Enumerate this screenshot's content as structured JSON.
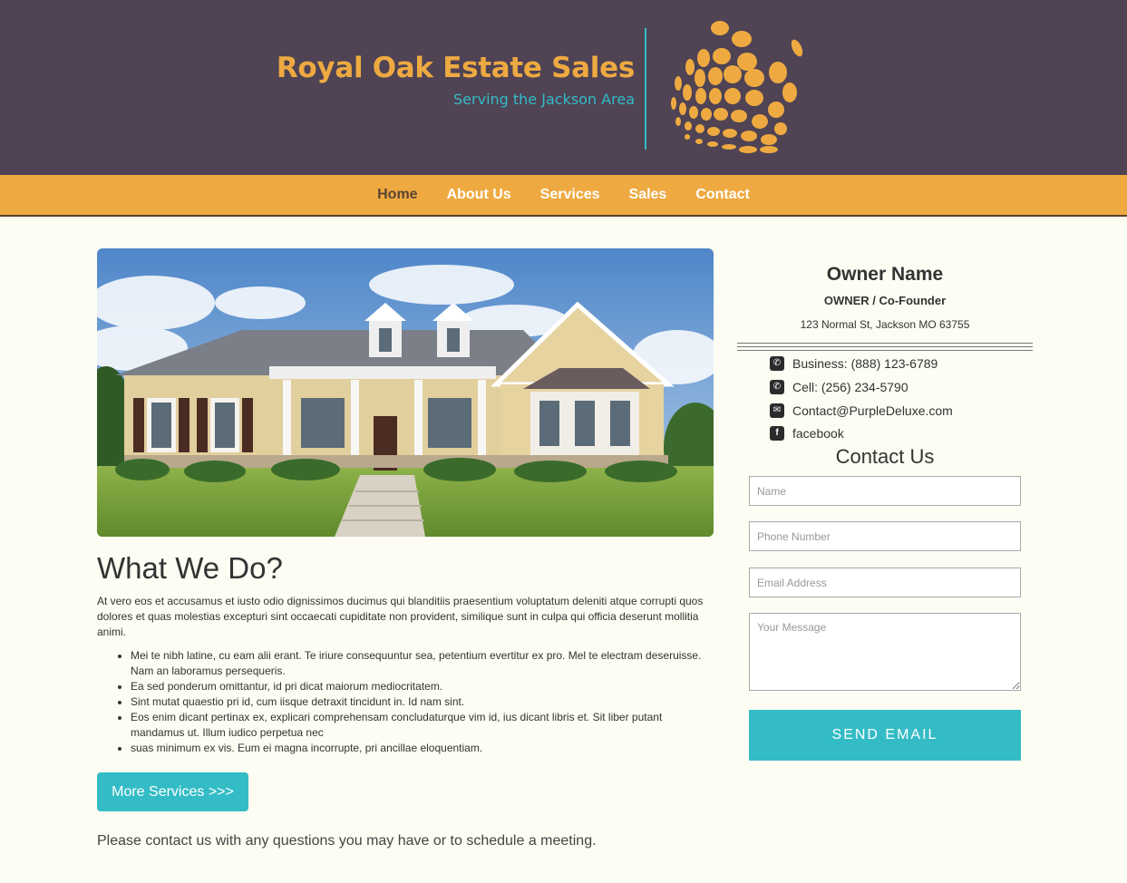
{
  "brand": {
    "title": "Royal Oak Estate Sales",
    "subtitle": "Serving the Jackson Area",
    "logo_icon": "dotted-sphere-logo"
  },
  "nav": {
    "items": [
      {
        "label": "Home",
        "active": true
      },
      {
        "label": "About Us",
        "active": false
      },
      {
        "label": "Services",
        "active": false
      },
      {
        "label": "Sales",
        "active": false
      },
      {
        "label": "Contact",
        "active": false
      }
    ]
  },
  "main": {
    "heading": "What We Do?",
    "paragraph": "At vero eos et accusamus et iusto odio dignissimos ducimus qui blanditiis praesentium voluptatum deleniti atque corrupti quos dolores et quas molestias excepturi sint occaecati cupiditate non provident, similique sunt in culpa qui officia deserunt mollitia animi.",
    "bullets": [
      "Mei te nibh latine, cu eam alii erant. Te iriure consequuntur sea, petentium evertitur ex pro. Mel te electram deseruisse. Nam an laboramus persequeris.",
      "Ea sed ponderum omittantur, id pri dicat maiorum mediocritatem.",
      "Sint mutat quaestio pri id, cum iisque detraxit tincidunt in. Id nam sint.",
      "Eos enim dicant pertinax ex, explicari comprehensam concludaturque vim id, ius dicant libris et. Sit liber putant mandamus ut. Illum iudico perpetua nec",
      "suas minimum ex vis. Eum ei magna incorrupte, pri ancillae eloquentiam."
    ],
    "more_button": "More Services >>>",
    "contact_note": "Please contact us with any questions you may have or to schedule a meeting."
  },
  "sidebar": {
    "owner_name": "Owner Name",
    "owner_role": "OWNER / Co-Founder",
    "address": "123 Normal St, Jackson MO 63755",
    "info": [
      {
        "icon": "phone-icon",
        "text": "Business: (888) 123-6789"
      },
      {
        "icon": "phone-icon",
        "text": "Cell: (256) 234-5790"
      },
      {
        "icon": "envelope-icon",
        "text": "Contact@PurpleDeluxe.com"
      },
      {
        "icon": "facebook-icon",
        "text": "facebook"
      }
    ],
    "contact_title": "Contact Us",
    "form": {
      "name_placeholder": "Name",
      "phone_placeholder": "Phone Number",
      "email_placeholder": "Email Address",
      "message_placeholder": "Your Message",
      "send_label": "SEND EMAIL"
    }
  },
  "colors": {
    "header_bg": "#4f4354",
    "accent_orange": "#eeaa41",
    "accent_teal": "#34bcc6",
    "page_bg": "#fdfdf3"
  }
}
